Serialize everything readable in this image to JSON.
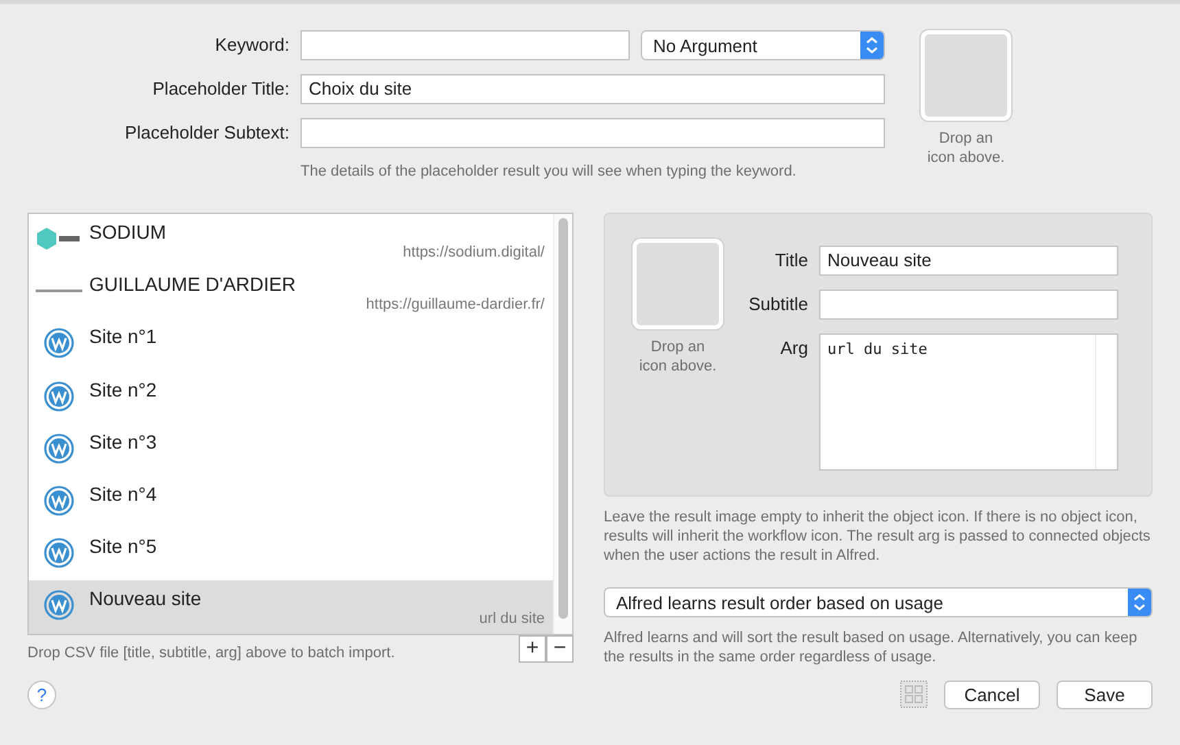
{
  "keyword": {
    "label": "Keyword:"
  },
  "argument_popup": {
    "value": "No Argument"
  },
  "placeholder_title": {
    "label": "Placeholder Title:",
    "value": "Choix du site"
  },
  "placeholder_subtext": {
    "label": "Placeholder Subtext:"
  },
  "placeholder_hint": "The details of the placeholder result you will see when typing the keyword.",
  "icon_well": {
    "caption": "Drop an icon above."
  },
  "results": [
    {
      "title": "SODIUM",
      "subtitle": "https://sodium.digital/",
      "kind": "hexagon",
      "selected": false
    },
    {
      "title": "GUILLAUME D'ARDIER",
      "subtitle": "https://guillaume-dardier.fr/",
      "kind": "strip",
      "selected": false
    },
    {
      "title": "Site n°1",
      "kind": "wordpress",
      "selected": false
    },
    {
      "title": "Site n°2",
      "kind": "wordpress",
      "selected": false
    },
    {
      "title": "Site n°3",
      "kind": "wordpress",
      "selected": false
    },
    {
      "title": "Site n°4",
      "kind": "wordpress",
      "selected": false
    },
    {
      "title": "Site n°5",
      "kind": "wordpress",
      "selected": false
    },
    {
      "title": "Nouveau site",
      "subtitle": "url du site",
      "kind": "wordpress",
      "selected": true
    }
  ],
  "list_hint": "Drop CSV file [title, subtitle, arg] above to batch import.",
  "add_button": "+",
  "remove_button": "−",
  "editor": {
    "icon_caption": "Drop an icon above.",
    "title_label": "Title",
    "title_value": "Nouveau site",
    "subtitle_label": "Subtitle",
    "arg_label": "Arg",
    "arg_value": "url du site"
  },
  "editor_hint": "Leave the result image empty to inherit the object icon. If there is no object icon, results will inherit the workflow icon. The result arg is passed to connected objects when the user actions the result in Alfred.",
  "order_popup": {
    "value": "Alfred learns result order based on usage"
  },
  "order_hint": "Alfred learns and will sort the result based on usage. Alternatively, you can keep the results in the same order regardless of usage.",
  "help_button": "?",
  "cancel_button": "Cancel",
  "save_button": "Save"
}
